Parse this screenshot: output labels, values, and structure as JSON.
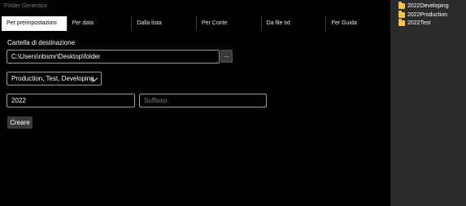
{
  "window": {
    "title": "Folder Generator"
  },
  "tabs": [
    {
      "label": "Per preimpostazioni"
    },
    {
      "label": "Per data"
    },
    {
      "label": "Dalla lista"
    },
    {
      "label": "Per Conte"
    },
    {
      "label": "Da file txt"
    },
    {
      "label": "Per Guida"
    }
  ],
  "destination": {
    "label": "Cartella di destinazione",
    "path": "C:\\Users\\nbsmr\\Desktop\\folder",
    "browse_label": "..."
  },
  "preset": {
    "selected": "Production, Test, Developing"
  },
  "prefix": {
    "value": "2022"
  },
  "suffix": {
    "placeholder": "Suffisso"
  },
  "actions": {
    "create_label": "Creare"
  },
  "preview": {
    "items": [
      {
        "name": "2022Developing"
      },
      {
        "name": "2022Production"
      },
      {
        "name": "2022Test"
      }
    ]
  }
}
